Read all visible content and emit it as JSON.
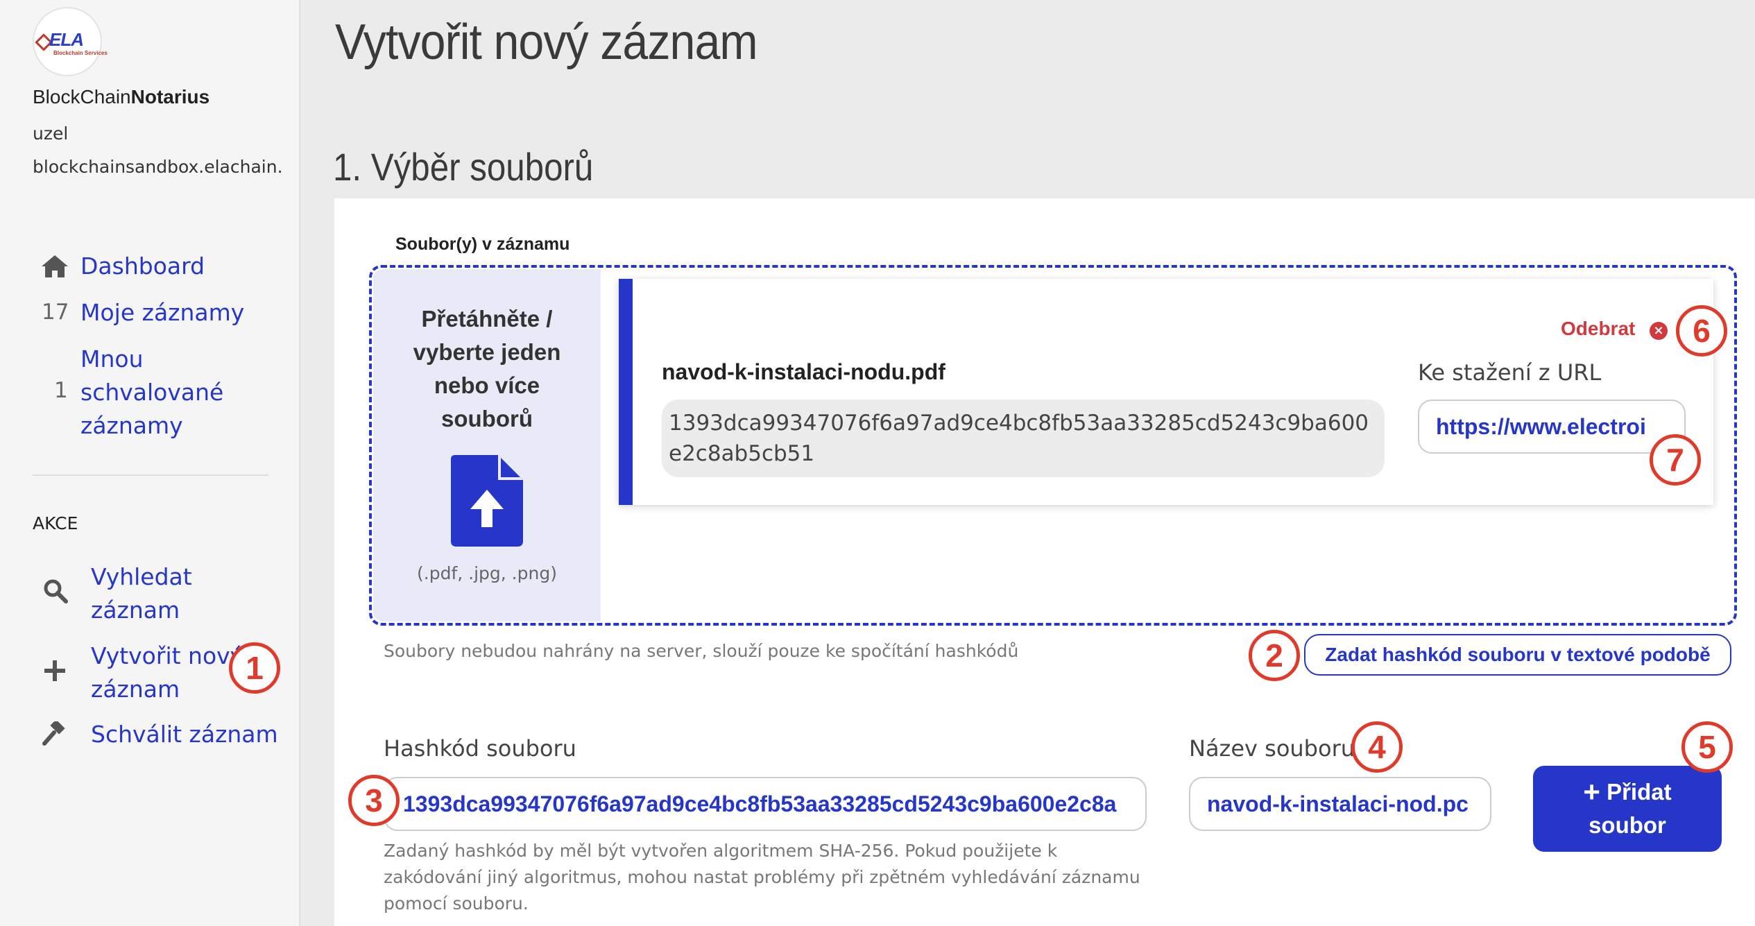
{
  "app": {
    "brand_prefix": "BlockChain",
    "brand_suffix": "Notarius",
    "node_label": "uzel",
    "node_host": "blockchainsandbox.elachain.cz",
    "logo_text": "ELA",
    "logo_sub": "Blockchain Services"
  },
  "sidebar": {
    "nav": [
      {
        "label": "Dashboard",
        "icon": "home-icon"
      },
      {
        "count": "17",
        "label": "Moje záznamy"
      },
      {
        "count": "1",
        "label_lines": [
          "Mnou",
          "schvalované",
          "záznamy"
        ]
      }
    ],
    "section_label": "AKCE",
    "actions": [
      {
        "label_lines": [
          "Vyhledat",
          "záznam"
        ],
        "icon": "search-icon"
      },
      {
        "label_lines": [
          "Vytvořit nový",
          "záznam"
        ],
        "icon": "plus-icon"
      },
      {
        "label": "Schválit záznam",
        "icon": "gavel-icon"
      }
    ]
  },
  "page": {
    "title": "Vytvořit nový záznam",
    "section_title": "1. Výběr souborů"
  },
  "files": {
    "label": "Soubor(y) v záznamu",
    "drop_text_lines": [
      "Přetáhněte /",
      "vyberte jeden",
      "nebo více",
      "souborů"
    ],
    "drop_hint": "(.pdf, .jpg, .png)",
    "note": "Soubory nebudou nahrány na server, slouží pouze ke spočítání hashkódů",
    "hash_text_button": "Zadat hashkód souboru v textové podobě",
    "card": {
      "remove_label": "Odebrat",
      "file_name": "navod-k-instalaci-nodu.pdf",
      "hash": "1393dca99347076f6a97ad9ce4bc8fb53aa33285cd5243c9ba600e2c8ab5cb51",
      "url_label": "Ke stažení z URL",
      "url_value": "https://www.electroi"
    }
  },
  "manual": {
    "hash_label": "Hashkód souboru",
    "hash_value": "1393dca99347076f6a97ad9ce4bc8fb53aa33285cd5243c9ba600e2c8a",
    "hash_help": "Zadaný hashkód by měl být vytvořen algoritmem SHA-256. Pokud použijete k zakódování jiný algoritmus, mohou nastat problémy při zpětném vyhledávání záznamu pomocí souboru.",
    "name_label": "Název souboru",
    "name_value": "navod-k-instalaci-nod.pc",
    "add_button": "Přidat soubor",
    "add_button_lines": [
      "Přidat",
      "soubor"
    ]
  },
  "callouts": [
    "1",
    "2",
    "3",
    "4",
    "5",
    "6",
    "7"
  ],
  "colors": {
    "accent": "#2536c9",
    "danger": "#d0393e",
    "callout": "#e03a2a"
  }
}
